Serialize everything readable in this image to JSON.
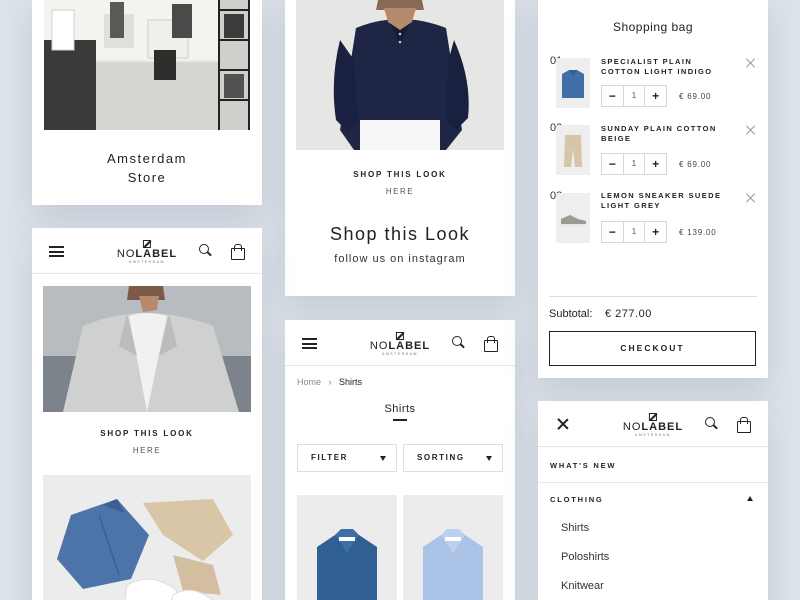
{
  "store_card": {
    "line1": "Amsterdam",
    "line2": "Store"
  },
  "look_card": {
    "shop_label": "SHOP THIS LOOK",
    "here_label": "HERE",
    "heading": "Shop this Look",
    "subheading": "follow us on instagram"
  },
  "brand": {
    "logo_light": "NO",
    "logo_bold": "LABEL",
    "logo_sub": "AMSTERDAM"
  },
  "home_card": {
    "shop_label": "SHOP THIS LOOK",
    "here_label": "HERE"
  },
  "shop_card": {
    "breadcrumb_home": "Home",
    "breadcrumb_sep": "›",
    "breadcrumb_current": "Shirts",
    "title": "Shirts",
    "filter_label": "FILTER",
    "sorting_label": "SORTING"
  },
  "bag": {
    "title": "Shopping bag",
    "items": [
      {
        "index": "01",
        "name_line1": "SPECIALIST PLAIN",
        "name_line2": "COTTON LIGHT INDIGO",
        "qty": "1",
        "price": "€ 69.00"
      },
      {
        "index": "02",
        "name_line1": "SUNDAY PLAIN COTTON",
        "name_line2": "BEIGE",
        "qty": "1",
        "price": "€ 69.00"
      },
      {
        "index": "03",
        "name_line1": "LEMON SNEAKER SUEDE",
        "name_line2": "LIGHT GREY",
        "qty": "1",
        "price": "€ 139.00"
      }
    ],
    "subtotal_label": "Subtotal:",
    "subtotal_value": "€ 277.00",
    "checkout_label": "CHECKOUT"
  },
  "menu": {
    "whats_new": "WHAT'S NEW",
    "clothing": "CLOTHING",
    "sub_items": [
      "Shirts",
      "Poloshirts",
      "Knitwear"
    ]
  },
  "colors": {
    "background": "#dde3ea",
    "text": "#222222",
    "card": "#ffffff"
  }
}
